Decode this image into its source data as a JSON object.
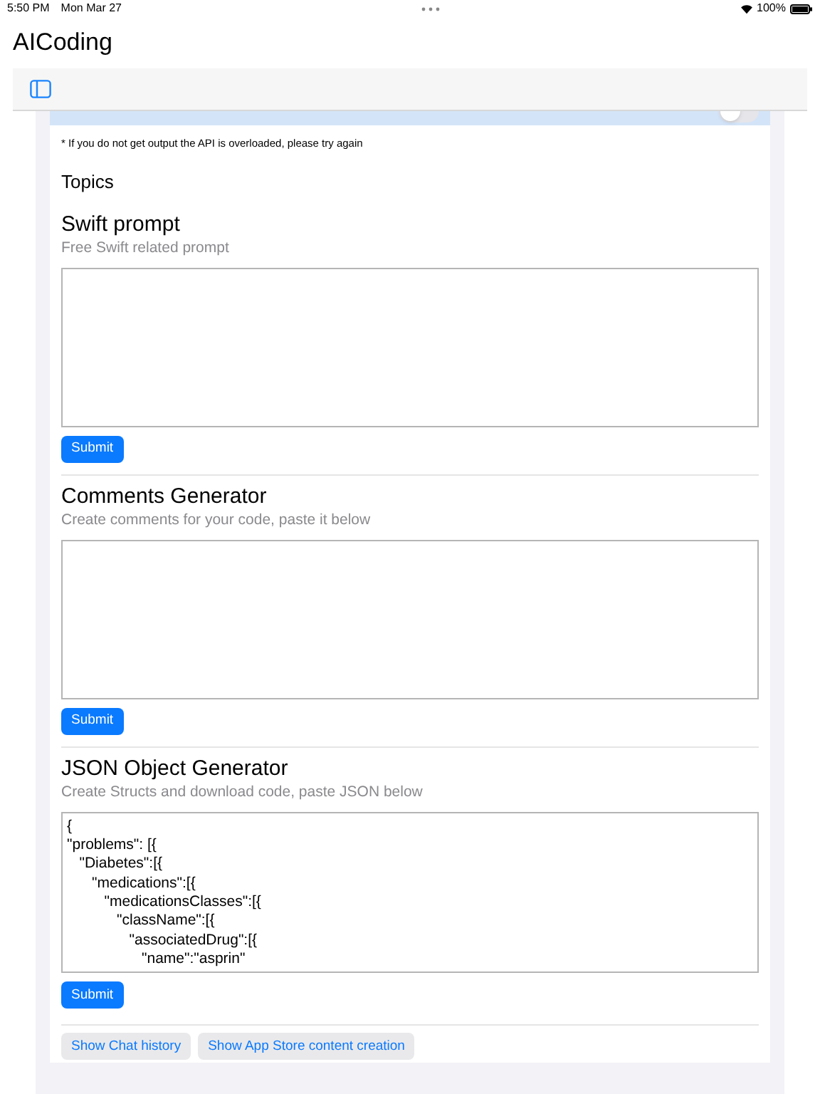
{
  "status_bar": {
    "time": "5:50 PM",
    "date": "Mon Mar 27",
    "battery": "100%"
  },
  "title": "AICoding",
  "speech_toggle": {
    "on": false
  },
  "notice": "* If you do not get output the API is overloaded, please try again",
  "topics_heading": "Topics",
  "sections": [
    {
      "title": "Swift prompt",
      "subtitle": "Free Swift related prompt",
      "button": "Submit"
    },
    {
      "title": "Comments Generator",
      "subtitle": "Create comments for your code, paste it below",
      "button": "Submit"
    },
    {
      "title": "JSON Object Generator",
      "subtitle": "Create Structs and download code, paste JSON below",
      "lines": [
        "{",
        "\"problems\": [{",
        "   \"Diabetes\":[{",
        "      \"medications\":[{",
        "         \"medicationsClasses\":[{",
        "            \"className\":[{",
        "               \"associatedDrug\":[{",
        "                  \"name\":\"asprin\""
      ],
      "button": "Submit"
    }
  ],
  "bottom_buttons": [
    "Show Chat history",
    "Show App Store content creation"
  ]
}
